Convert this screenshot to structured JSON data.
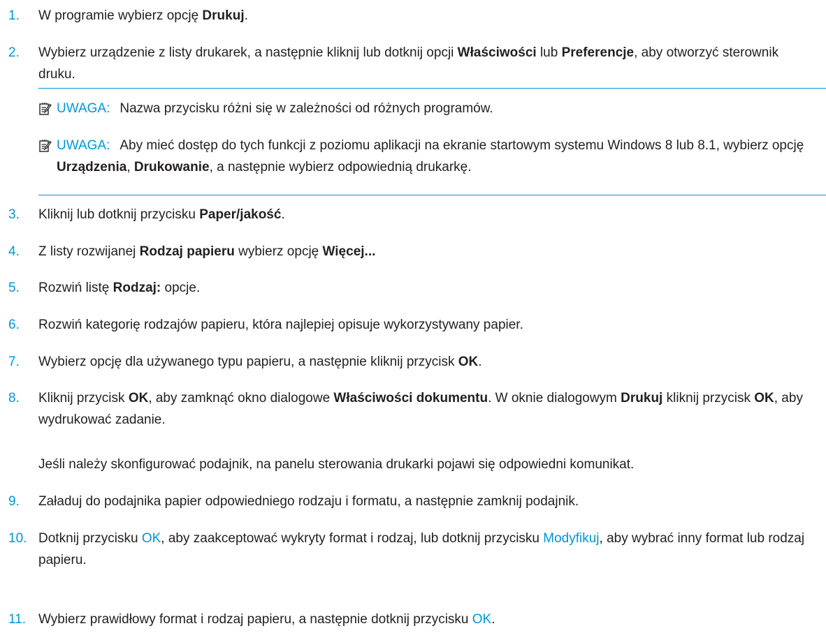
{
  "colors": {
    "accent": "#0096d6",
    "text": "#231f20"
  },
  "steps": [
    {
      "num": "1.",
      "parts": [
        "W programie wybierz opcję ",
        "Drukuj",
        "."
      ]
    },
    {
      "num": "2.",
      "parts": [
        "Wybierz urządzenie z listy drukarek, a następnie kliknij lub dotknij opcji ",
        "Właściwości",
        " lub ",
        "Preferencje",
        ", aby otworzyć sterownik druku."
      ]
    },
    {
      "num": "3.",
      "parts": [
        "Kliknij lub dotknij przycisku ",
        "Paper/jakość",
        "."
      ]
    },
    {
      "num": "4.",
      "parts": [
        "Z listy rozwijanej ",
        "Rodzaj papieru",
        " wybierz opcję ",
        "Więcej..."
      ]
    },
    {
      "num": "5.",
      "parts": [
        "Rozwiń listę ",
        "Rodzaj:",
        " opcje."
      ]
    },
    {
      "num": "6.",
      "parts": [
        "Rozwiń kategorię rodzajów papieru, która najlepiej opisuje wykorzystywany papier."
      ]
    },
    {
      "num": "7.",
      "parts": [
        "Wybierz opcję dla używanego typu papieru, a następnie kliknij przycisk ",
        "OK",
        "."
      ]
    },
    {
      "num": "8.",
      "parts": [
        "Kliknij przycisk ",
        "OK",
        ", aby zamknąć okno dialogowe ",
        "Właściwości dokumentu",
        ". W oknie dialogowym ",
        "Drukuj",
        " kliknij przycisk ",
        "OK",
        ", aby wydrukować zadanie."
      ]
    },
    {
      "num": "9.",
      "parts": [
        "Załaduj do podajnika papier odpowiedniego rodzaju i formatu, a następnie zamknij podajnik."
      ]
    },
    {
      "num": "10.",
      "parts": [
        "Dotknij przycisku ",
        "OK",
        ", aby zaakceptować wykryty format i rodzaj, lub dotknij przycisku ",
        "Modyfikuj",
        ", aby wybrać inny format lub rodzaj papieru."
      ]
    },
    {
      "num": "11.",
      "parts": [
        "Wybierz prawidłowy format i rodzaj papieru, a następnie dotknij przycisku ",
        "OK",
        "."
      ]
    }
  ],
  "notes": [
    {
      "label": "UWAGA:",
      "parts": [
        "Nazwa przycisku różni się w zależności od różnych programów."
      ]
    },
    {
      "label": "UWAGA:",
      "parts": [
        "Aby mieć dostęp do tych funkcji z poziomu aplikacji na ekranie startowym systemu Windows 8 lub 8.1, wybierz opcję ",
        "Urządzenia",
        ", ",
        "Drukowanie",
        ", a następnie wybierz odpowiednią drukarkę."
      ]
    }
  ],
  "step8_followup": "Jeśli należy skonfigurować podajnik, na panelu sterowania drukarki pojawi się odpowiedni komunikat."
}
